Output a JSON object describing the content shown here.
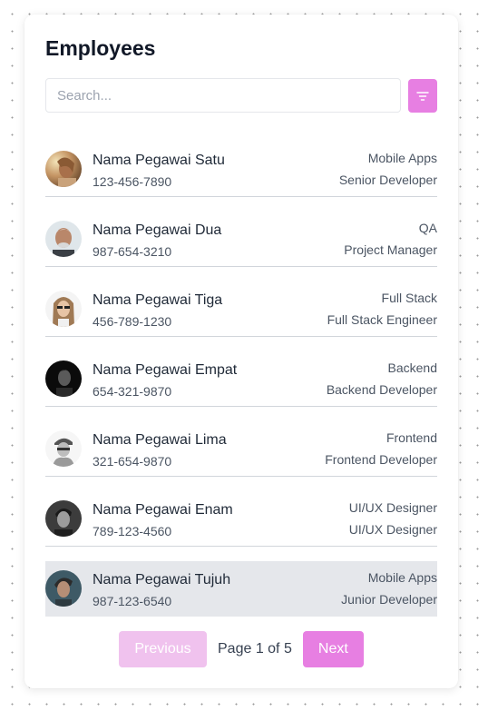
{
  "header": {
    "title": "Employees"
  },
  "search": {
    "placeholder": "Search...",
    "value": ""
  },
  "filter_button": {
    "icon": "filter-icon",
    "color": "#e77fe2"
  },
  "employees": [
    {
      "name": "Nama Pegawai Satu",
      "phone": "123-456-7890",
      "department": "Mobile Apps",
      "role": "Senior Developer",
      "selected": false
    },
    {
      "name": "Nama Pegawai Dua",
      "phone": "987-654-3210",
      "department": "QA",
      "role": "Project Manager",
      "selected": false
    },
    {
      "name": "Nama Pegawai Tiga",
      "phone": "456-789-1230",
      "department": "Full Stack",
      "role": "Full Stack Engineer",
      "selected": false
    },
    {
      "name": "Nama Pegawai Empat",
      "phone": "654-321-9870",
      "department": "Backend",
      "role": "Backend Developer",
      "selected": false
    },
    {
      "name": "Nama Pegawai Lima",
      "phone": "321-654-9870",
      "department": "Frontend",
      "role": "Frontend Developer",
      "selected": false
    },
    {
      "name": "Nama Pegawai Enam",
      "phone": "789-123-4560",
      "department": "UI/UX Designer",
      "role": "UI/UX Designer",
      "selected": false
    },
    {
      "name": "Nama Pegawai Tujuh",
      "phone": "987-123-6540",
      "department": "Mobile Apps",
      "role": "Junior Developer",
      "selected": true
    }
  ],
  "pagination": {
    "previous_label": "Previous",
    "next_label": "Next",
    "page_info": "Page 1 of 5",
    "previous_disabled": true,
    "accent_color": "#e77fe2",
    "disabled_color": "#f0c2ee"
  },
  "colors": {
    "selected_row_background": "#e5e7eb",
    "divider": "#d1d5db"
  }
}
